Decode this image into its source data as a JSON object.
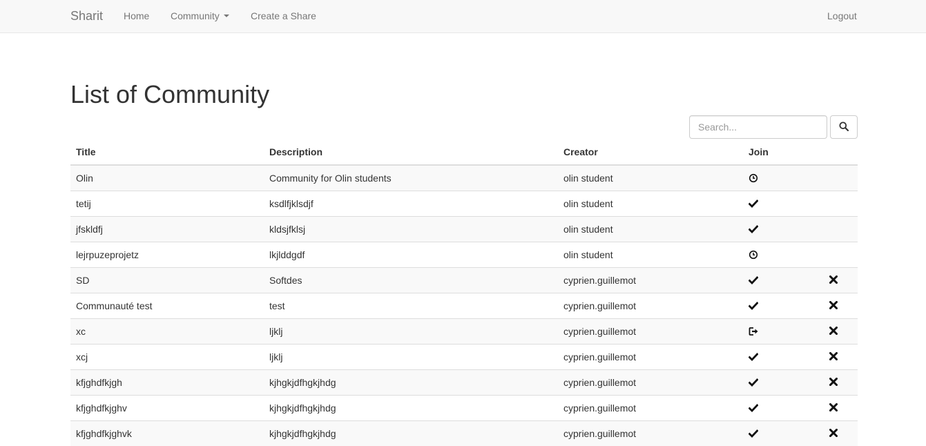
{
  "navbar": {
    "brand": "Sharit",
    "home": "Home",
    "community": "Community",
    "create_share": "Create a Share",
    "logout": "Logout"
  },
  "page": {
    "title": "List of Community"
  },
  "search": {
    "placeholder": "Search...",
    "value": ""
  },
  "table": {
    "columns": [
      "Title",
      "Description",
      "Creator",
      "Join",
      ""
    ],
    "rows": [
      {
        "title": "Olin",
        "description": "Community for Olin students",
        "creator": "olin student",
        "join_icon": "clock-icon",
        "delete_icon": ""
      },
      {
        "title": "tetij",
        "description": "ksdlfjklsdjf",
        "creator": "olin student",
        "join_icon": "check-icon",
        "delete_icon": ""
      },
      {
        "title": "jfskldfj",
        "description": "kldsjfklsj",
        "creator": "olin student",
        "join_icon": "check-icon",
        "delete_icon": ""
      },
      {
        "title": "lejrpuzeprojetz",
        "description": "lkjlddgdf",
        "creator": "olin student",
        "join_icon": "clock-icon",
        "delete_icon": ""
      },
      {
        "title": "SD",
        "description": "Softdes",
        "creator": "cyprien.guillemot",
        "join_icon": "check-icon",
        "delete_icon": "remove-icon"
      },
      {
        "title": "Communauté test",
        "description": "test",
        "creator": "cyprien.guillemot",
        "join_icon": "check-icon",
        "delete_icon": "remove-icon"
      },
      {
        "title": "xc",
        "description": "ljklj",
        "creator": "cyprien.guillemot",
        "join_icon": "log-in-icon",
        "delete_icon": "remove-icon"
      },
      {
        "title": "xcj",
        "description": "ljklj",
        "creator": "cyprien.guillemot",
        "join_icon": "check-icon",
        "delete_icon": "remove-icon"
      },
      {
        "title": "kfjghdfkjgh",
        "description": "kjhgkjdfhgkjhdg",
        "creator": "cyprien.guillemot",
        "join_icon": "check-icon",
        "delete_icon": "remove-icon"
      },
      {
        "title": "kfjghdfkjghv",
        "description": "kjhgkjdfhgkjhdg",
        "creator": "cyprien.guillemot",
        "join_icon": "check-icon",
        "delete_icon": "remove-icon"
      },
      {
        "title": "kfjghdfkjghvk",
        "description": "kjhgkjdfhgkjhdg",
        "creator": "cyprien.guillemot",
        "join_icon": "check-icon",
        "delete_icon": "remove-icon"
      }
    ]
  }
}
